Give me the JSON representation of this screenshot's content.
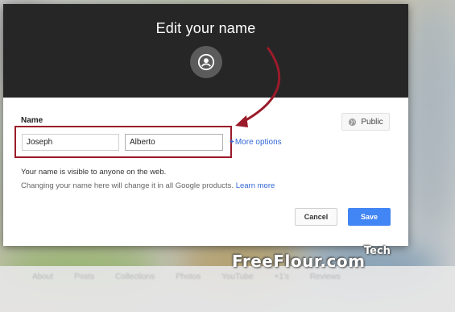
{
  "dialog": {
    "title": "Edit your name",
    "name_label": "Name",
    "first_name": "Joseph",
    "last_name": "Alberto",
    "more_options": "More options",
    "more_options_prefix": "+",
    "visibility_button": "Public",
    "visibility_note": "Your name is visible to anyone on the web.",
    "change_note": "Changing your name here will change it in all Google products.",
    "learn_more": "Learn more",
    "cancel_label": "Cancel",
    "save_label": "Save"
  },
  "background_nav": [
    "About",
    "Posts",
    "Collections",
    "Photos",
    "YouTube",
    "+1's",
    "Reviews"
  ],
  "watermark": {
    "main": "FreeFlour.com",
    "tech": "Tech"
  },
  "colors": {
    "header": "#262626",
    "accent": "#4285f4",
    "link": "#3367d6",
    "highlight": "#9b1b2a"
  },
  "icons": {
    "avatar": "account-circle-icon",
    "public": "globe-icon",
    "arrow": "curved-arrow-annotation"
  }
}
